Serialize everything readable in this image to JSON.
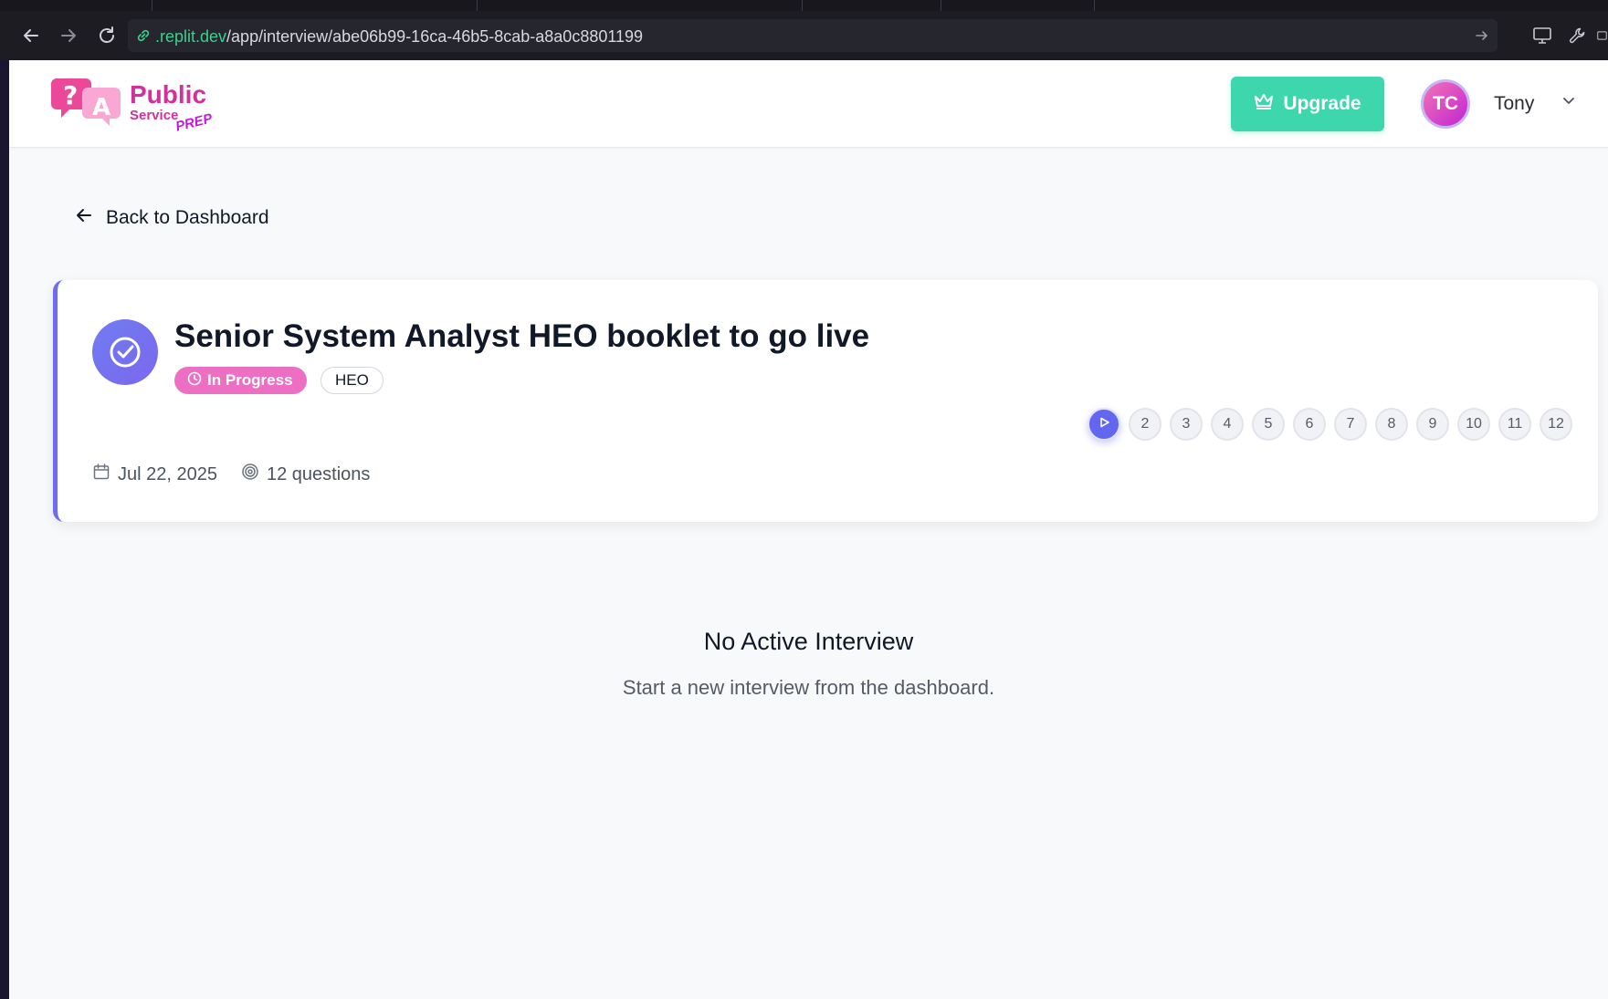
{
  "browser": {
    "url_host": ".replit.dev",
    "url_path": "/app/interview/abe06b99-16ca-46b5-8cab-a8a0c8801199",
    "icons": [
      "back-icon",
      "forward-icon",
      "reload-icon",
      "link-icon",
      "go-icon",
      "monitor-icon",
      "wrench-icon"
    ]
  },
  "header": {
    "logo": {
      "line1": "Public",
      "line2": "Service",
      "line3": "PREP"
    },
    "upgrade_label": "Upgrade",
    "avatar_initials": "TC",
    "user_name": "Tony",
    "colors": {
      "upgrade": "#3ed6ad",
      "brand": "#d3319a"
    }
  },
  "nav": {
    "back_label": "Back to Dashboard"
  },
  "interview": {
    "title": "Senior System Analyst HEO booklet to go live",
    "status": "In Progress",
    "level": "HEO",
    "date": "Jul 22, 2025",
    "question_count": "12 questions",
    "steps": [
      "2",
      "3",
      "4",
      "5",
      "6",
      "7",
      "8",
      "9",
      "10",
      "11",
      "12"
    ],
    "current_step": 1,
    "accent": "#6f6cf0"
  },
  "empty_state": {
    "title": "No Active Interview",
    "subtitle": "Start a new interview from the dashboard."
  }
}
